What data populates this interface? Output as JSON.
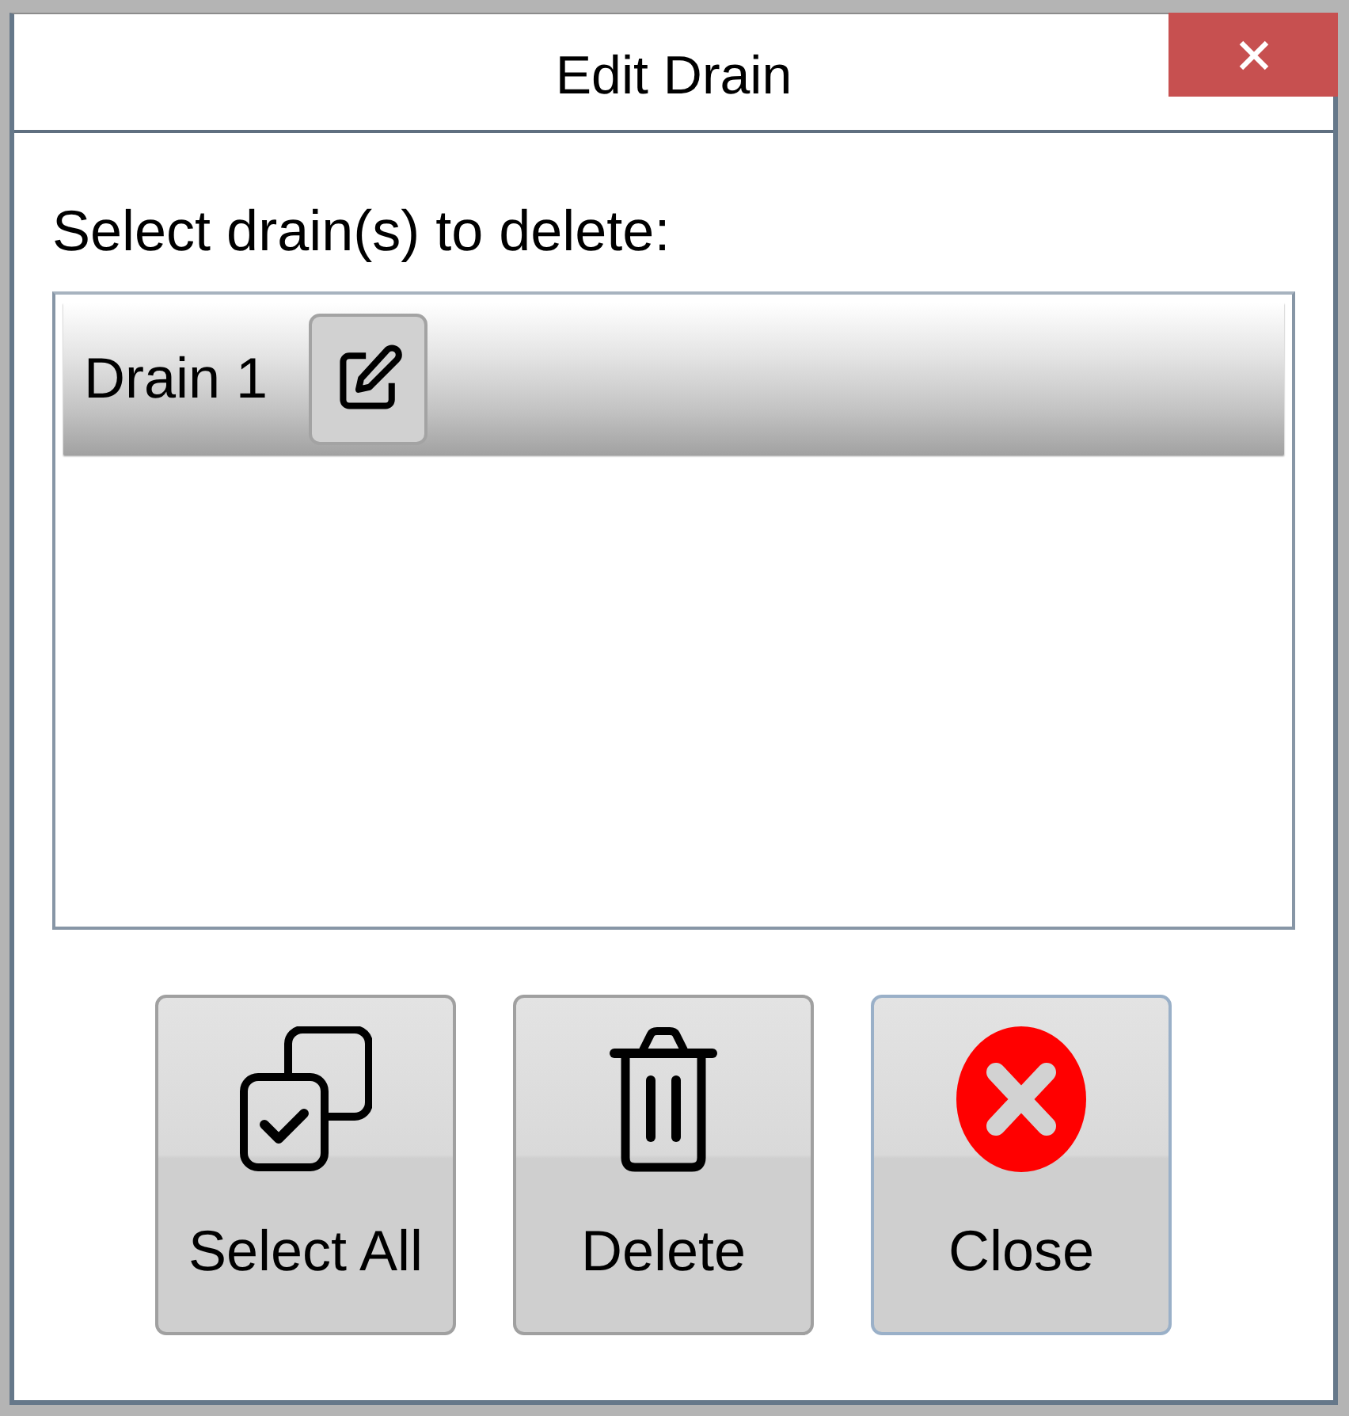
{
  "window": {
    "title": "Edit Drain"
  },
  "prompt": "Select drain(s) to delete:",
  "drains": [
    {
      "name": "Drain 1",
      "selected": true
    }
  ],
  "buttons": [
    {
      "label": "Select All",
      "kind": "select-all",
      "focused": false
    },
    {
      "label": "Delete",
      "kind": "delete",
      "focused": false
    },
    {
      "label": "Close",
      "kind": "close",
      "focused": true
    }
  ]
}
